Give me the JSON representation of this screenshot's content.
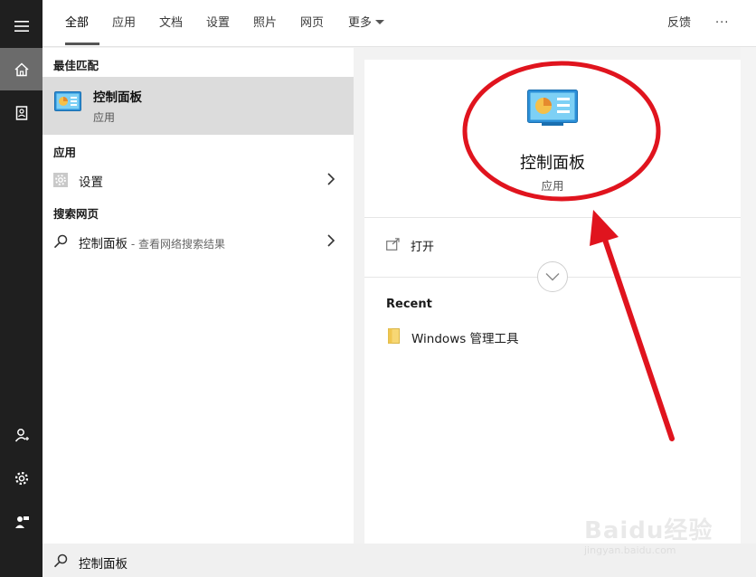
{
  "tabs": [
    {
      "label": "全部",
      "active": true
    },
    {
      "label": "应用"
    },
    {
      "label": "文档"
    },
    {
      "label": "设置"
    },
    {
      "label": "照片"
    },
    {
      "label": "网页"
    },
    {
      "label": "更多"
    }
  ],
  "header": {
    "feedback": "反馈",
    "more_options": "···"
  },
  "left": {
    "best_match_heading": "最佳匹配",
    "best_match": {
      "title": "控制面板",
      "subtitle": "应用",
      "icon": "control-panel-icon"
    },
    "apps_heading": "应用",
    "settings_item": {
      "label": "设置",
      "icon": "gear-icon"
    },
    "web_heading": "搜索网页",
    "web_item": {
      "label": "控制面板",
      "hint": " - 查看网络搜索结果",
      "icon": "search-icon"
    }
  },
  "right": {
    "title": "控制面板",
    "subtitle": "应用",
    "open_label": "打开",
    "recent_heading": "Recent",
    "recent_items": [
      {
        "label": "Windows 管理工具",
        "icon": "folder-icon"
      }
    ]
  },
  "search": {
    "value": "控制面板"
  },
  "watermark": {
    "text": "Baidu经验",
    "url": "jingyan.baidu.com"
  },
  "colors": {
    "annotation_red": "#e0141e",
    "active_nav": "#6b6b6b",
    "taskbar": "#1f1f1f",
    "best_match_bg": "#dcdcdc"
  }
}
